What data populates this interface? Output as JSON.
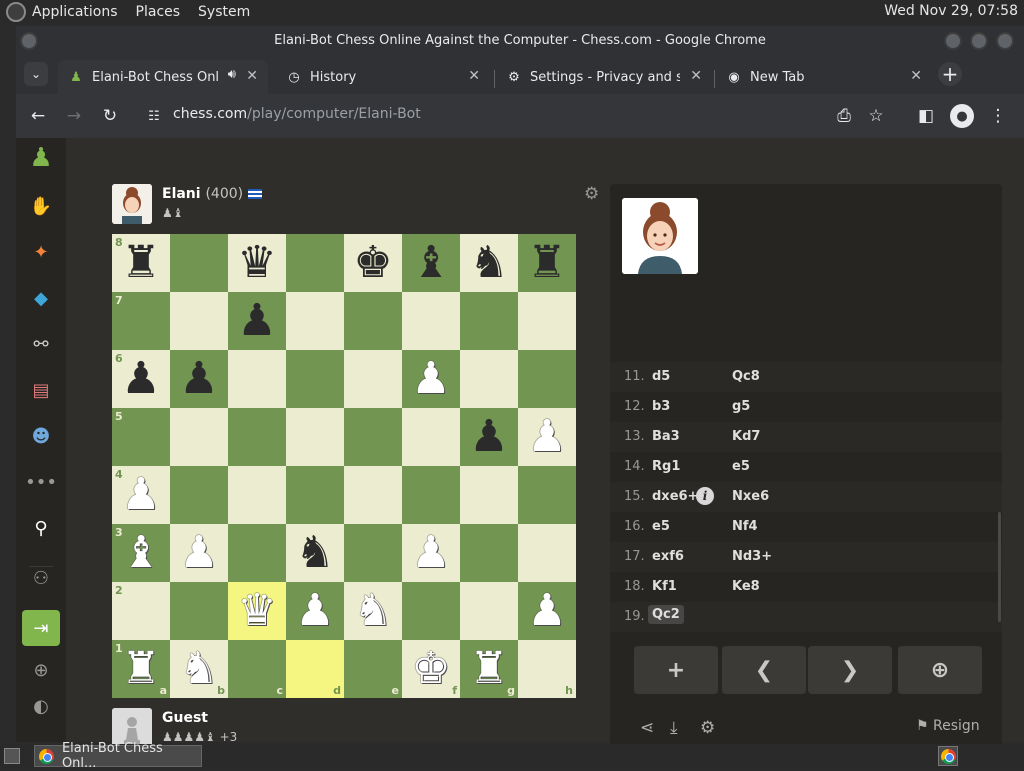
{
  "os": {
    "menus": [
      "Applications",
      "Places",
      "System"
    ],
    "clock": "Wed Nov 29, 07:58"
  },
  "window": {
    "title": "Elani-Bot Chess Online Against the Computer - Chess.com - Google Chrome"
  },
  "tabs": [
    {
      "title": "Elani-Bot Chess Onli",
      "icon": "pawn-icon",
      "active": true,
      "audio": true
    },
    {
      "title": "History",
      "icon": "history-icon"
    },
    {
      "title": "Settings - Privacy and sec",
      "icon": "gear-icon"
    },
    {
      "title": "New Tab",
      "icon": "chrome-icon"
    }
  ],
  "url": {
    "domain": "chess.com",
    "path": "/play/computer/Elani-Bot"
  },
  "opponent": {
    "name": "Elani",
    "rating": "(400)",
    "captured": "♟♝",
    "flag": "greece-flag"
  },
  "player": {
    "name": "Guest",
    "captured": "♟♟♟♟♝",
    "advantage": "+3"
  },
  "board": {
    "rank_labels": [
      "8",
      "7",
      "6",
      "5",
      "4",
      "3",
      "2",
      "1"
    ],
    "file_labels": [
      "a",
      "b",
      "c",
      "d",
      "e",
      "f",
      "g",
      "h"
    ],
    "position": [
      [
        "bR",
        "",
        "bQ",
        "",
        "bK",
        "bB",
        "bN",
        "bR"
      ],
      [
        "",
        "",
        "bP",
        "",
        "",
        "",
        "",
        ""
      ],
      [
        "bP",
        "bP",
        "",
        "",
        "",
        "wP",
        "",
        ""
      ],
      [
        "",
        "",
        "",
        "",
        "",
        "",
        "bP",
        "wP"
      ],
      [
        "wP",
        "",
        "",
        "",
        "",
        "",
        "",
        ""
      ],
      [
        "wB",
        "wP",
        "",
        "bN",
        "",
        "wP",
        "",
        ""
      ],
      [
        "",
        "",
        "wQ",
        "wP",
        "wN",
        "",
        "",
        "wP"
      ],
      [
        "wR",
        "wN",
        "",
        "",
        "",
        "wK",
        "wR",
        ""
      ]
    ],
    "highlights": [
      "c2",
      "d1"
    ],
    "colors": {
      "light": "#ebecd0",
      "dark": "#739552",
      "highlight": "#f5f682"
    }
  },
  "moves": [
    {
      "n": "11.",
      "w": "d5",
      "b": "Qc8"
    },
    {
      "n": "12.",
      "w": "b3",
      "b": "g5"
    },
    {
      "n": "13.",
      "w": "Ba3",
      "b": "Kd7"
    },
    {
      "n": "14.",
      "w": "Rg1",
      "b": "e5"
    },
    {
      "n": "15.",
      "w": "dxe6+",
      "b": "Nxe6",
      "info": true
    },
    {
      "n": "16.",
      "w": "e5",
      "b": "Nf4"
    },
    {
      "n": "17.",
      "w": "exf6",
      "b": "Nd3+"
    },
    {
      "n": "18.",
      "w": "Kf1",
      "b": "Ke8"
    },
    {
      "n": "19.",
      "w": "Qc2",
      "b": "",
      "current": true
    }
  ],
  "controls": {
    "new": "+",
    "prev": "❮",
    "next": "❯",
    "analyze": "⊕"
  },
  "footer": {
    "resign": "Resign"
  },
  "taskbar": {
    "task_title": "Elani-Bot Chess Onl..."
  }
}
